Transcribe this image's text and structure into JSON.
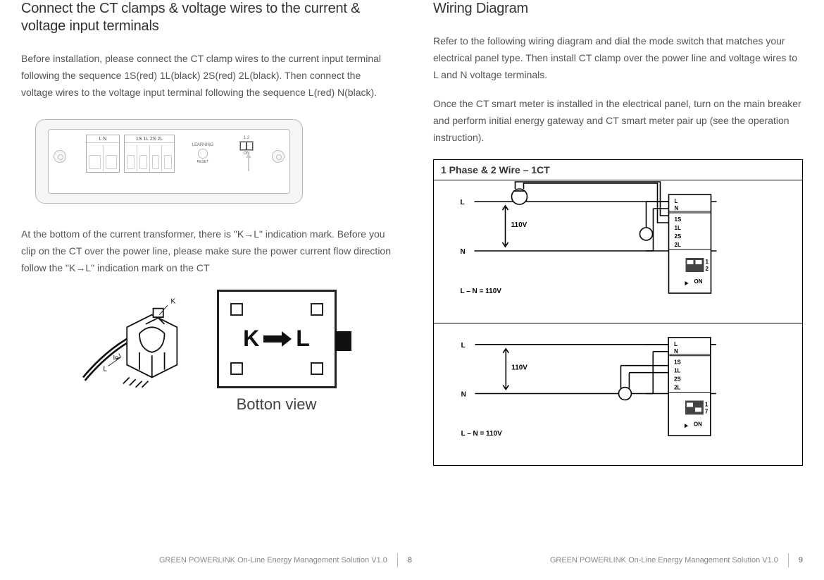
{
  "left": {
    "heading": "Connect the CT clamps & voltage wires to the current & voltage input terminals",
    "p1": "Before installation, please connect the CT clamp wires to the current input terminal following the sequence 1S(red) 1L(black) 2S(red) 2L(black). Then connect the voltage wires to the voltage input terminal following the sequence L(red) N(black).",
    "p2": "At the bottom of the current transformer, there is \"K→L\" indication mark. Before you clip on the CT over the power line, please make sure the power current flow direction follow the \"K→L\" indication mark on the CT",
    "device": {
      "ln": "L   N",
      "ct": "1S 1L 2S 2L",
      "learning": "LEARNING",
      "reset": "RESET",
      "dip_nums": "1 2",
      "dip_on": "ON"
    },
    "bottom_view": {
      "k": "K",
      "l": "L",
      "caption": "Botton view"
    },
    "ct_labels": {
      "k": "K",
      "l": "L",
      "io": "Io"
    }
  },
  "right": {
    "heading": "Wiring Diagram",
    "p1": "Refer to the following wiring diagram and dial the mode switch that matches your electrical panel type. Then install CT clamp over the power line and voltage wires to L and N voltage terminals.",
    "p2": "Once the CT smart meter is installed in the electrical panel, turn on the main breaker and perform initial energy gateway and CT smart meter pair up (see the operation instruction).",
    "wiring_title": "1 Phase & 2 Wire – 1CT",
    "wiring_labels": {
      "L": "L",
      "N": "N",
      "v": "110V",
      "lv": "L – N = 110V",
      "terms": [
        "L",
        "N",
        "1S",
        "1L",
        "2S",
        "2L"
      ],
      "mode1": [
        "1",
        "2"
      ],
      "mode2": [
        "1",
        "7"
      ],
      "on": "ON"
    }
  },
  "footer": {
    "text": "GREEN POWERLINK On-Line Energy Management Solution   V1.0",
    "page_left": "8",
    "page_right": "9"
  }
}
